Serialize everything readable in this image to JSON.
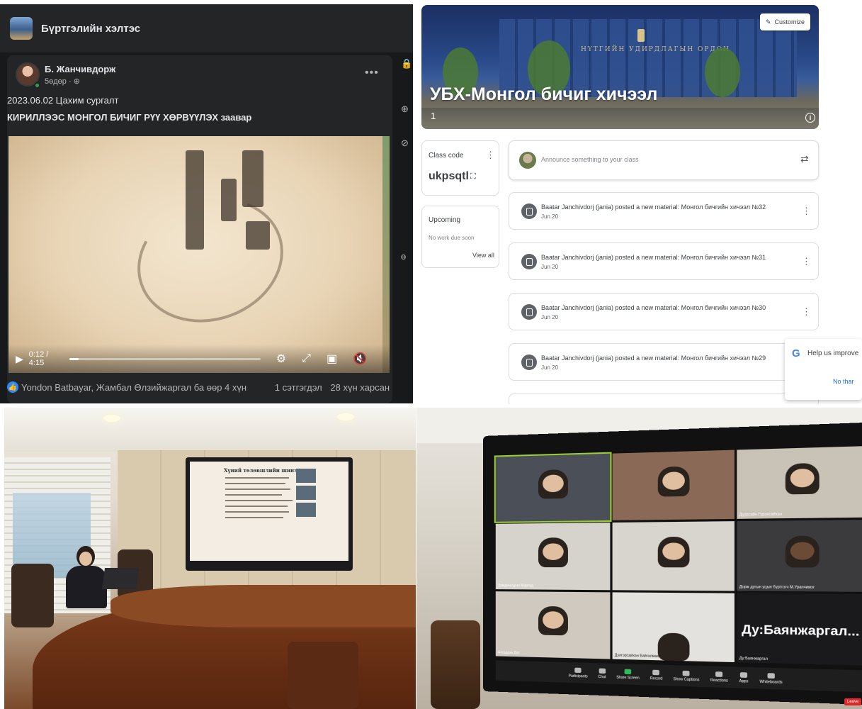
{
  "facebook": {
    "group_title": "Бүртгэлийн хэлтэс",
    "post": {
      "author": "Б. Жанчивдорж",
      "meta": "5өдөр · ⊕",
      "line1": "2023.06.02 Цахим сургалт",
      "line2": "КИРИЛЛЭЭС МОНГОЛ БИЧИГ РҮҮ ХӨРВҮҮЛЭХ заавар",
      "more_icon": "more-horizontal-icon",
      "video": {
        "time": "0:12 / 4:15",
        "progress_fraction": 0.05
      },
      "reactions_names": "Yondon Batbayar, Жамбал Өлзийжаргал ба өөр 4 хүн",
      "comments_count": "1 сэтгэгдэл",
      "views_count": "28 хүн харсан"
    },
    "side_strip_chars": [
      "🔒",
      "⊕",
      "⊘",
      "ө"
    ]
  },
  "classroom": {
    "customize_label": "Customize",
    "class_title": "УБХ-Монгол бичиг хичээл",
    "class_section": "1",
    "banner_text": "НҮТГИЙН УДИРДЛАГЫН ОРДОН",
    "class_code_label": "Class code",
    "class_code": "ukpsqtl",
    "upcoming_title": "Upcoming",
    "upcoming_empty": "No work due soon",
    "view_all": "View all",
    "announce_placeholder": "Announce something to your class",
    "posts": [
      {
        "text": "Baatar Janchivdorj (jania) posted a new material: Монгол бичгийн хичээл №32",
        "date": "Jun 20"
      },
      {
        "text": "Baatar Janchivdorj (jania) posted a new material: Монгол бичгийн хичээл №31",
        "date": "Jun 20"
      },
      {
        "text": "Baatar Janchivdorj (jania) posted a new material: Монгол бичгийн хичээл №30",
        "date": "Jun 20"
      },
      {
        "text": "Baatar Janchivdorj (jania) posted a new material: Монгол бичгийн хичээл №29",
        "date": "Jun 20"
      }
    ],
    "help_text": "Help us improve",
    "help_no": "No thar"
  },
  "room": {
    "slide_title": "Хүний төлөвшлийн шинэчлэл"
  },
  "zoom": {
    "tiles": [
      {
        "label": ""
      },
      {
        "label": ""
      },
      {
        "label": "Дуурсайн Гүрэнсайхан"
      },
      {
        "label": "Дамдинсүрэн Маргад"
      },
      {
        "label": ""
      },
      {
        "label": "Дорж дугын уцын бүртгэгч М.Уранчимэг"
      },
      {
        "label": "Алгадахь Бат"
      },
      {
        "label": "Дэлгэрсайхан Байгалмаа"
      },
      {
        "label": "Ду:Баянжаргал..."
      }
    ],
    "big_name": "Ду:Баянжаргал...",
    "big_sub": "Ду:Баянжаргал",
    "toolbar": [
      "Participants",
      "Chat",
      "Share Screen",
      "Record",
      "Show Captions",
      "Reactions",
      "Apps",
      "Whiteboards"
    ],
    "leave": "Leave"
  }
}
